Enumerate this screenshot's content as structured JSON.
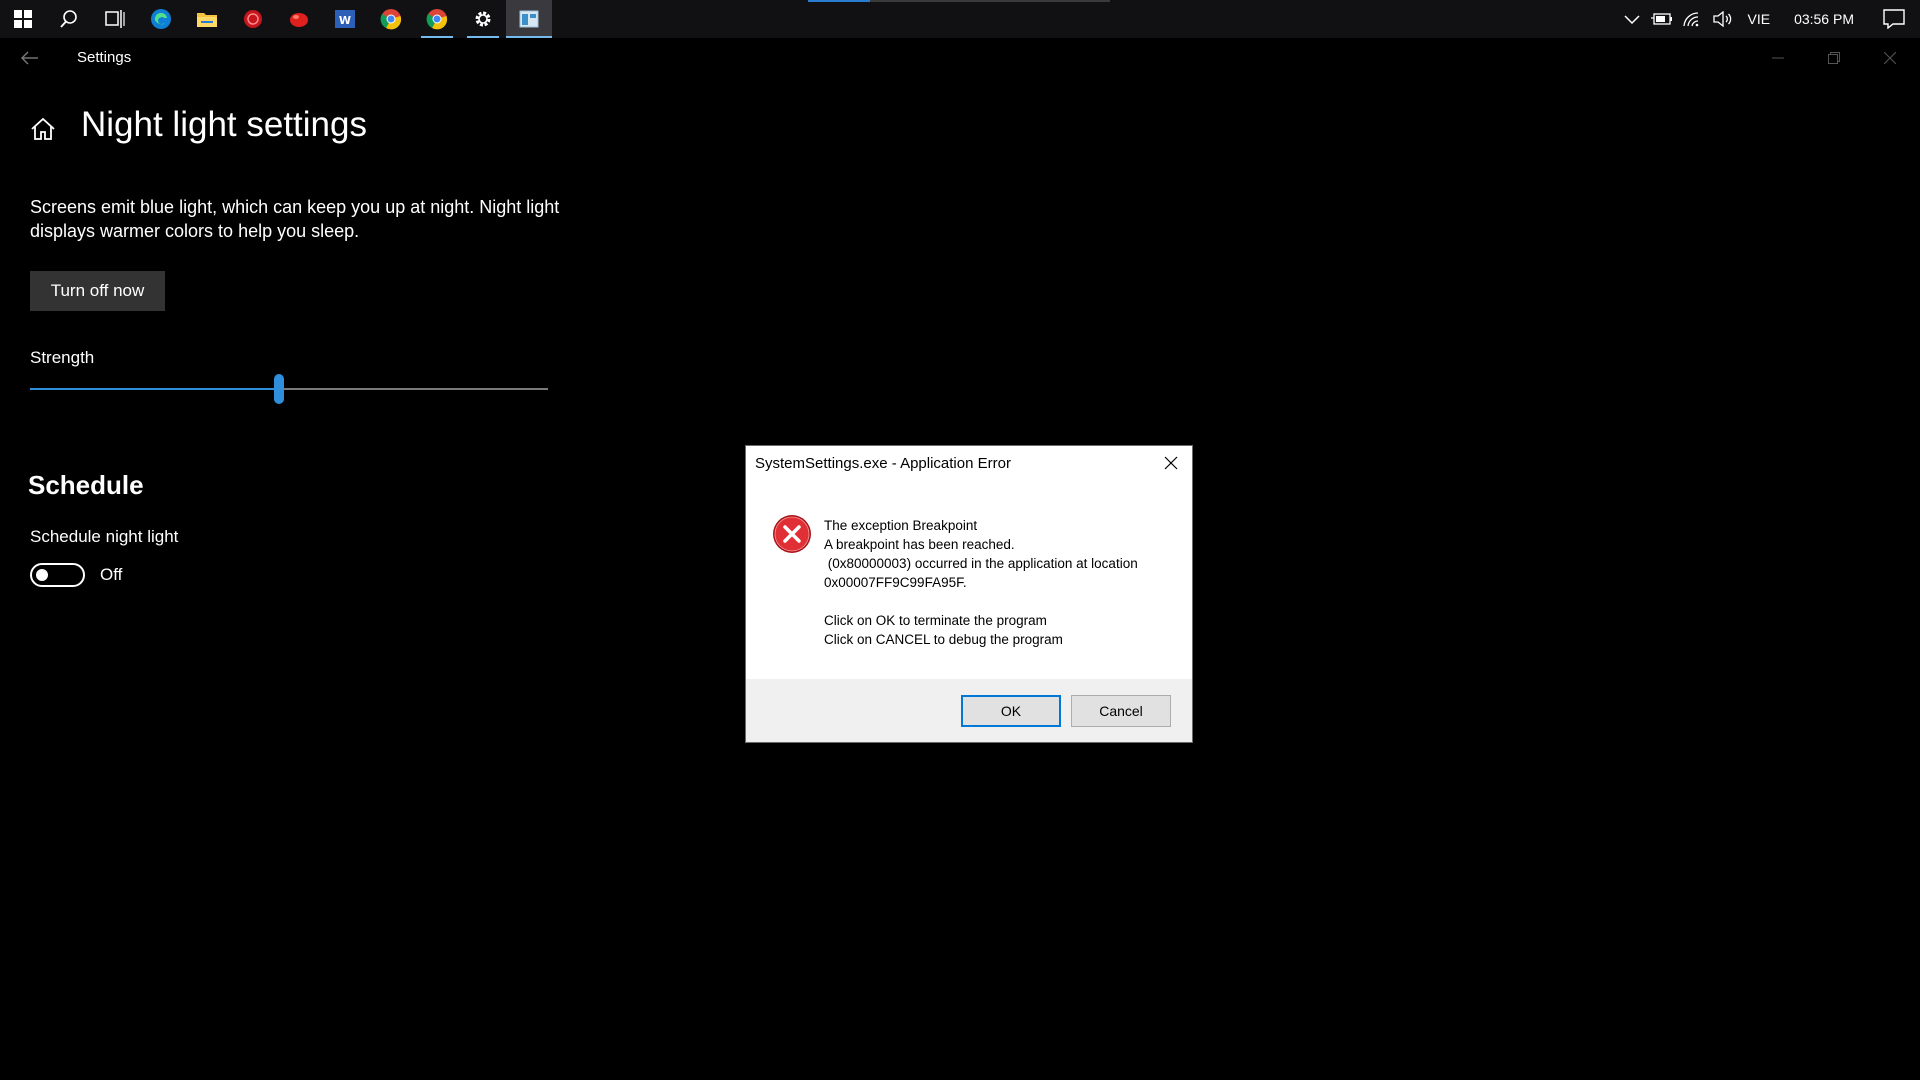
{
  "taskbar": {
    "apps": [
      {
        "name": "start-icon",
        "running": false
      },
      {
        "name": "search-icon",
        "running": false
      },
      {
        "name": "task-view-icon",
        "running": false
      },
      {
        "name": "edge-icon",
        "running": false
      },
      {
        "name": "file-explorer-icon",
        "running": false
      },
      {
        "name": "red-app-icon",
        "running": false
      },
      {
        "name": "red-ball-app-icon",
        "running": false
      },
      {
        "name": "word-icon",
        "running": false
      },
      {
        "name": "chrome-icon",
        "running": false
      },
      {
        "name": "chrome-icon-2",
        "running": true
      },
      {
        "name": "settings-gear-icon",
        "running": true
      },
      {
        "name": "window-app-icon",
        "running": true,
        "active": true
      }
    ],
    "tray": {
      "language": "VIE",
      "clock": "03:56 PM"
    }
  },
  "window": {
    "app_title": "Settings"
  },
  "page": {
    "title": "Night light settings",
    "description": "Screens emit blue light, which can keep you up at night. Night light displays warmer colors to help you sleep.",
    "turn_off_label": "Turn off now",
    "strength_label": "Strength",
    "strength_value": 0.48,
    "schedule_heading": "Schedule",
    "schedule_label": "Schedule night light",
    "schedule_state": "Off"
  },
  "dialog": {
    "title": "SystemSettings.exe - Application Error",
    "lines": [
      "The exception Breakpoint",
      "A breakpoint has been reached.",
      " (0x80000003) occurred in the application at location",
      "0x00007FF9C99FA95F.",
      "",
      "Click on OK to terminate the program",
      "Click on CANCEL to debug the program"
    ],
    "ok_label": "OK",
    "cancel_label": "Cancel"
  },
  "colors": {
    "accent": "#0078d7",
    "slider": "#2f8fdd",
    "error_red": "#d9262b"
  }
}
